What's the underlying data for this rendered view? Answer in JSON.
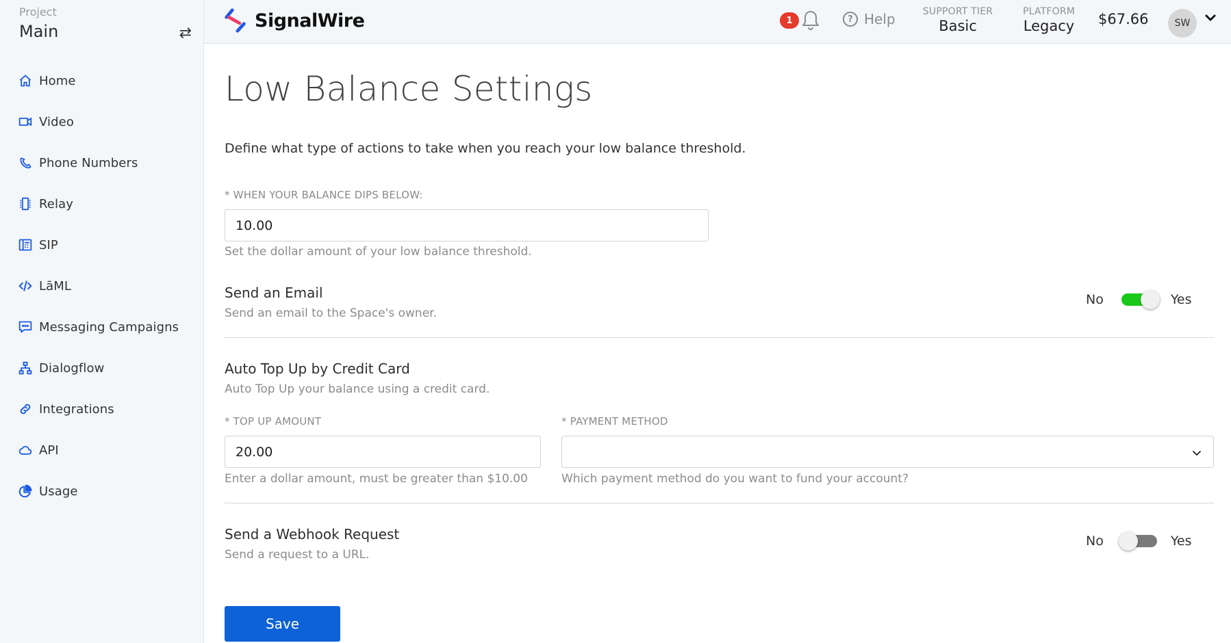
{
  "project": {
    "label": "Project",
    "name": "Main",
    "switch_icon": "swap-arrows-icon"
  },
  "sidebar": {
    "items": [
      {
        "label": "Home",
        "icon": "home-icon"
      },
      {
        "label": "Video",
        "icon": "video-camera-icon"
      },
      {
        "label": "Phone Numbers",
        "icon": "phone-icon"
      },
      {
        "label": "Relay",
        "icon": "chip-icon"
      },
      {
        "label": "SIP",
        "icon": "desk-phone-icon"
      },
      {
        "label": "LāML",
        "icon": "code-icon"
      },
      {
        "label": "Messaging Campaigns",
        "icon": "chat-bubble-icon"
      },
      {
        "label": "Dialogflow",
        "icon": "network-tree-icon"
      },
      {
        "label": "Integrations",
        "icon": "link-icon"
      },
      {
        "label": "API",
        "icon": "cloud-icon"
      },
      {
        "label": "Usage",
        "icon": "pie-chart-icon"
      }
    ]
  },
  "header": {
    "brand": "SignalWire",
    "notification_count": "1",
    "help_label": "Help",
    "support_tier": {
      "label": "SUPPORT TIER",
      "value": "Basic"
    },
    "platform": {
      "label": "PLATFORM",
      "value": "Legacy"
    },
    "balance": "$67.66",
    "avatar_initials": "SW"
  },
  "colors": {
    "accent": "#0d62d8",
    "icon_blue": "#1a5ce6",
    "toggle_on": "#19c919",
    "toggle_off": "#7a7a7a",
    "badge_red": "#e53b2c"
  },
  "page": {
    "title": "Low Balance Settings",
    "intro": "Define what type of actions to take when you reach your low balance threshold.",
    "threshold": {
      "label": "* WHEN YOUR BALANCE DIPS BELOW:",
      "value": "10.00",
      "hint": "Set the dollar amount of your low balance threshold."
    },
    "email": {
      "title": "Send an Email",
      "desc": "Send an email to the Space's owner.",
      "no_label": "No",
      "yes_label": "Yes",
      "enabled": true
    },
    "auto_top_up": {
      "title": "Auto Top Up by Credit Card",
      "desc": "Auto Top Up your balance using a credit card.",
      "amount_label": "* TOP UP AMOUNT",
      "amount_value": "20.00",
      "amount_hint": "Enter a dollar amount, must be greater than $10.00",
      "payment_label": "* PAYMENT METHOD",
      "payment_value": "",
      "payment_hint": "Which payment method do you want to fund your account?"
    },
    "webhook": {
      "title": "Send a Webhook Request",
      "desc": "Send a request to a URL.",
      "no_label": "No",
      "yes_label": "Yes",
      "enabled": false
    },
    "save_label": "Save"
  }
}
